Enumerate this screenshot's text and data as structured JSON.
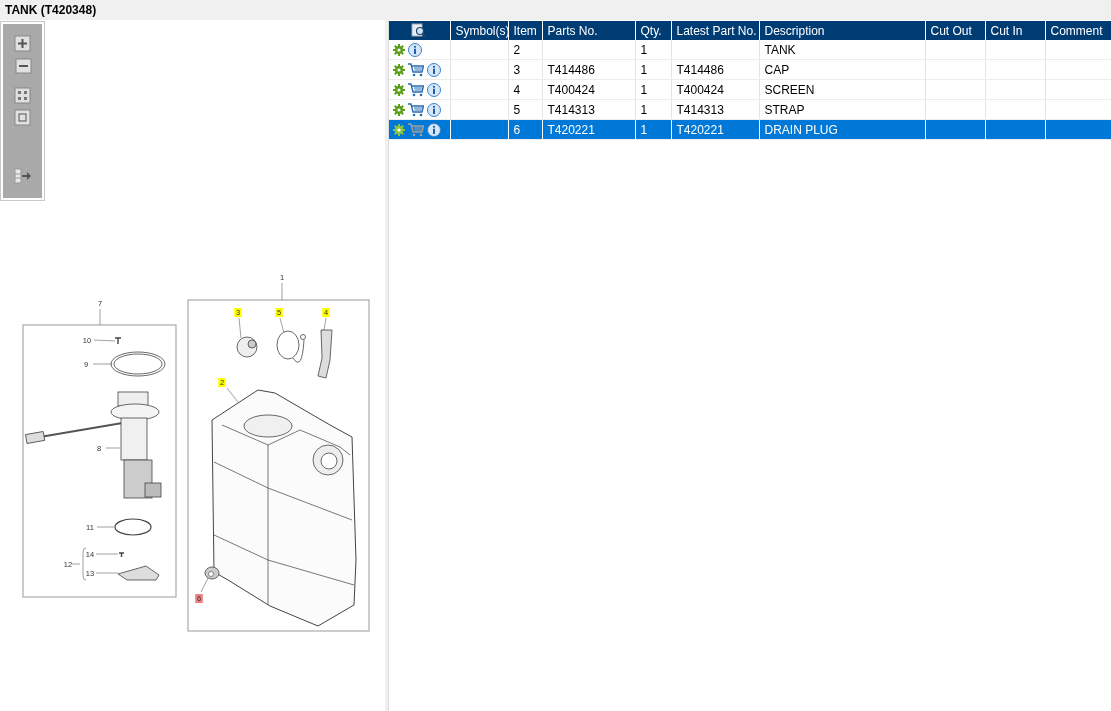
{
  "title": "TANK (T420348)",
  "diagram": {
    "callouts": [
      {
        "label": "1",
        "highlighted": false,
        "selected": false
      },
      {
        "label": "7",
        "highlighted": false,
        "selected": false
      },
      {
        "label": "10",
        "highlighted": false,
        "selected": false
      },
      {
        "label": "9",
        "highlighted": false,
        "selected": false
      },
      {
        "label": "8",
        "highlighted": false,
        "selected": false
      },
      {
        "label": "11",
        "highlighted": false,
        "selected": false
      },
      {
        "label": "12",
        "highlighted": false,
        "selected": false
      },
      {
        "label": "14",
        "highlighted": false,
        "selected": false
      },
      {
        "label": "13",
        "highlighted": false,
        "selected": false
      },
      {
        "label": "3",
        "highlighted": true,
        "selected": false
      },
      {
        "label": "5",
        "highlighted": true,
        "selected": false
      },
      {
        "label": "4",
        "highlighted": true,
        "selected": false
      },
      {
        "label": "2",
        "highlighted": true,
        "selected": false
      },
      {
        "label": "6",
        "highlighted": true,
        "selected": true
      }
    ]
  },
  "table": {
    "columns": [
      "Symbol(s)",
      "Item",
      "Parts No.",
      "Qty.",
      "Latest Part No.",
      "Description",
      "Cut Out",
      "Cut In",
      "Comment"
    ],
    "rows": [
      {
        "cart": false,
        "item": "2",
        "parts_no": "",
        "qty": "1",
        "latest_part_no": "",
        "description": "TANK",
        "selected": false
      },
      {
        "cart": true,
        "item": "3",
        "parts_no": "T414486",
        "qty": "1",
        "latest_part_no": "T414486",
        "description": "CAP",
        "selected": false
      },
      {
        "cart": true,
        "item": "4",
        "parts_no": "T400424",
        "qty": "1",
        "latest_part_no": "T400424",
        "description": "SCREEN",
        "selected": false
      },
      {
        "cart": true,
        "item": "5",
        "parts_no": "T414313",
        "qty": "1",
        "latest_part_no": "T414313",
        "description": "STRAP",
        "selected": false
      },
      {
        "cart": true,
        "item": "6",
        "parts_no": "T420221",
        "qty": "1",
        "latest_part_no": "T420221",
        "description": "DRAIN PLUG",
        "selected": true
      }
    ]
  }
}
